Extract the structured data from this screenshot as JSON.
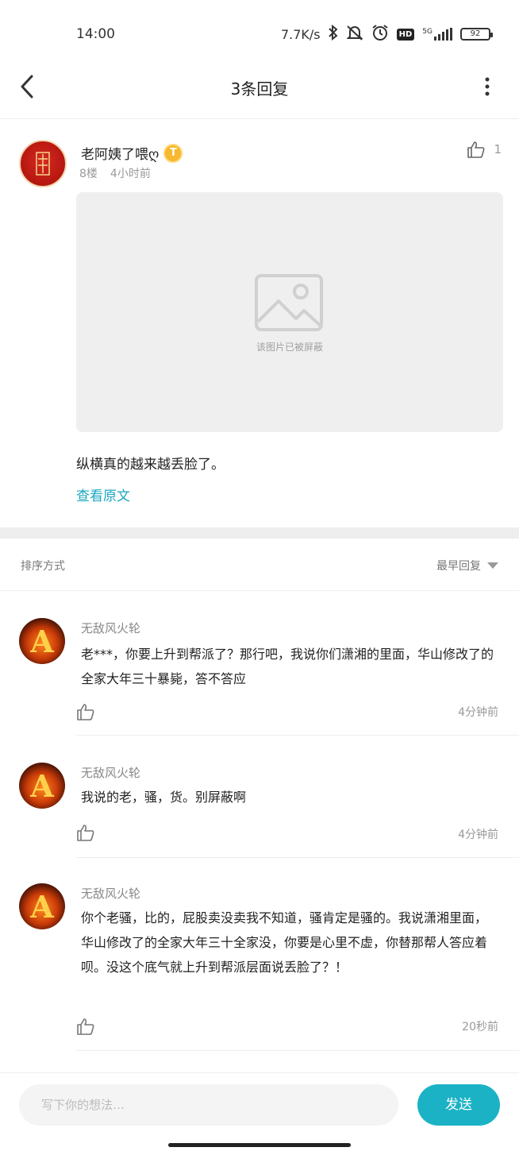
{
  "status_bar": {
    "time": "14:00",
    "network_speed": "7.7K/s",
    "hd": "HD",
    "network_type": "5G",
    "battery": "92"
  },
  "nav": {
    "title": "3条回复"
  },
  "post": {
    "author": "老阿姨了喂ღ",
    "author_badge": "T",
    "floor": "8楼",
    "time_ago": "4小时前",
    "like_count": "1",
    "image_blocked_text": "该图片已被屏蔽",
    "body": "纵横真的越来越丢脸了。",
    "view_original": "查看原文"
  },
  "sort": {
    "label": "排序方式",
    "selected": "最早回复"
  },
  "replies": [
    {
      "author": "无敌风火轮",
      "text": "老***，你要上升到帮派了？那行吧，我说你们潇湘的里面，华山修改了的全家大年三十暴毙，答不答应",
      "time": "4分钟前"
    },
    {
      "author": "无敌风火轮",
      "text": "我说的老，骚，货。别屏蔽啊",
      "time": "4分钟前"
    },
    {
      "author": "无敌风火轮",
      "text": "你个老骚，比的，屁股卖没卖我不知道，骚肯定是骚的。我说潇湘里面，华山修改了的全家大年三十全家没，你要是心里不虚，你替那帮人答应着呗。没这个底气就上升到帮派层面说丢脸了？！",
      "time": "20秒前"
    }
  ],
  "compose": {
    "placeholder": "写下你的想法…",
    "send_label": "发送"
  },
  "colors": {
    "accent": "#1bb2c6",
    "link": "#1aa7bf"
  }
}
